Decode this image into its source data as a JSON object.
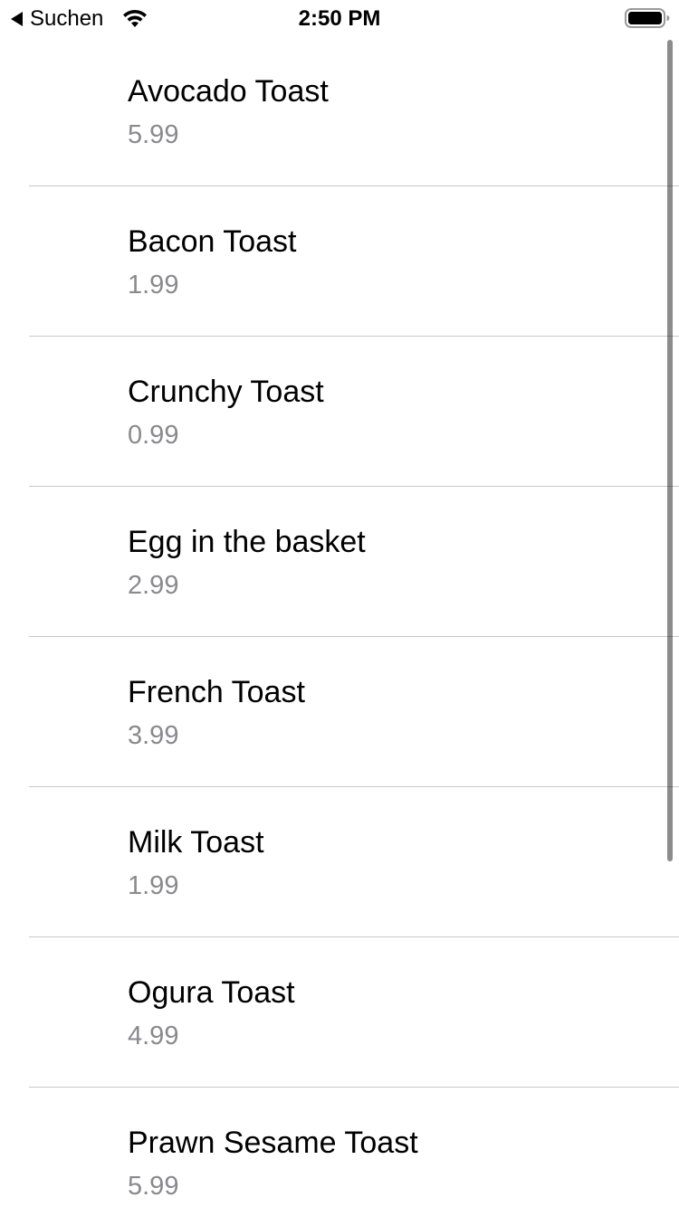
{
  "status_bar": {
    "back_label": "Suchen",
    "time": "2:50 PM",
    "icons": [
      "back-arrow-icon",
      "wifi-icon",
      "battery-icon"
    ]
  },
  "menu": {
    "items": [
      {
        "name": "Avocado Toast",
        "price": "5.99"
      },
      {
        "name": "Bacon Toast",
        "price": "1.99"
      },
      {
        "name": "Crunchy Toast",
        "price": "0.99"
      },
      {
        "name": "Egg in the basket",
        "price": "2.99"
      },
      {
        "name": "French Toast",
        "price": "3.99"
      },
      {
        "name": "Milk Toast",
        "price": "1.99"
      },
      {
        "name": "Ogura Toast",
        "price": "4.99"
      },
      {
        "name": "Prawn Sesame Toast",
        "price": "5.99"
      }
    ]
  },
  "colors": {
    "background": "#ffffff",
    "title_text": "#000000",
    "price_text": "#8a8a8e",
    "separator": "#c8c7cc"
  }
}
